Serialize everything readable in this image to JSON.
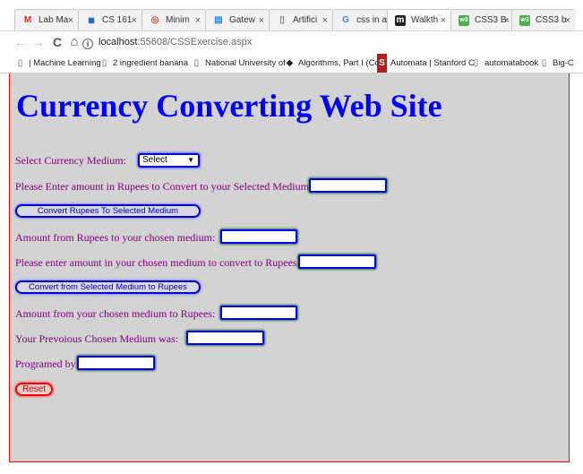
{
  "browser": {
    "tabs": [
      {
        "icon": "gmail-icon",
        "glyph": "M",
        "title": "Lab Ma",
        "color": "#d93025"
      },
      {
        "icon": "mm-icon",
        "glyph": "▦",
        "title": "CS 161",
        "color": "#1a5fb4"
      },
      {
        "icon": "circle-icon",
        "glyph": "◎",
        "title": "Minim",
        "color": "#e53935"
      },
      {
        "icon": "doc-icon",
        "glyph": "▤",
        "title": "Gatew",
        "color": "#1e88e5"
      },
      {
        "icon": "page-icon",
        "glyph": "▯",
        "title": "Artifici",
        "color": "#777777"
      },
      {
        "icon": "google-icon",
        "glyph": "G",
        "title": "css in a",
        "color": "#4285f4"
      },
      {
        "icon": "m-icon",
        "glyph": "m",
        "title": "Walkth",
        "color": "#222222"
      },
      {
        "icon": "w3-icon",
        "glyph": "w3",
        "title": "CSS3 B",
        "color": "#4caf50"
      },
      {
        "icon": "w3-icon",
        "glyph": "w3",
        "title": "CSS3 b",
        "color": "#4caf50"
      }
    ],
    "close_glyph": "×",
    "nav": {
      "back": "←",
      "forward": "→",
      "reload": "C",
      "home": "⌂"
    },
    "url": {
      "host": "localhost",
      "path": ":55608/CSSExercise.aspx"
    },
    "bookmarks": [
      {
        "icon": "page-icon",
        "glyph": "▯",
        "label": "| Machine Learning"
      },
      {
        "icon": "page-icon",
        "glyph": "▯",
        "label": "2 ingredient banana"
      },
      {
        "icon": "page-icon",
        "glyph": "▯",
        "label": "National University of"
      },
      {
        "icon": "algorithms-icon",
        "glyph": "◆",
        "label": "Algorithms, Part I (Co"
      },
      {
        "icon": "stanford-icon",
        "glyph": "S",
        "label": "Automata | Stanford C"
      },
      {
        "icon": "page-icon",
        "glyph": "▯",
        "label": "automatabook"
      },
      {
        "icon": "page-icon",
        "glyph": "▯",
        "label": "Big-C"
      }
    ]
  },
  "page": {
    "heading": "Currency Converting Web Site",
    "select_label": "Select Currency Medium:",
    "select_value": "Select",
    "select_arrow": "▼",
    "rupees_input_label": "Please Enter amount in Rupees to Convert to your Selected Medium:",
    "rupees_input_value": "",
    "convert_rupees_button": "Convert Rupees To Selected Medium",
    "amount_from_rupees_label": "Amount from Rupees to your chosen medium:",
    "amount_from_rupees_value": "",
    "medium_input_label": "Please enter amount in your chosen medium to convert to Rupees:",
    "medium_input_value": "",
    "convert_medium_button": "Convert from Selected Medium to Rupees",
    "amount_from_medium_label": "Amount from your chosen medium to Rupees:",
    "amount_from_medium_value": "",
    "previous_medium_label": "Your Prevoious Chosen Medium was:",
    "previous_medium_value": "",
    "programmed_by_label": "Programed by:",
    "programmed_by_value": "",
    "reset_button": "Reset"
  },
  "colors": {
    "page_background": "#d3d3d3",
    "heading": "#0000ff",
    "label_text": "#800080",
    "control_border": "#0000ff",
    "reset_border": "#ff0000",
    "frame_border": "#ff0000"
  }
}
